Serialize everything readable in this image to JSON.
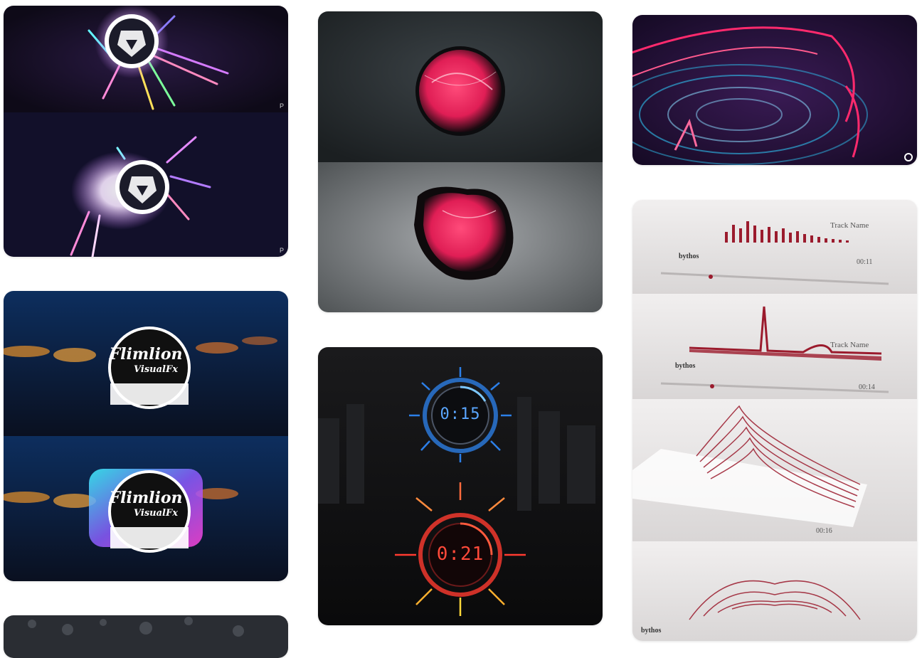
{
  "gallery": {
    "lion_card": {
      "watermark_top": "P",
      "watermark_bottom": "P"
    },
    "flimlion_card": {
      "logo_line1": "Flimlion",
      "logo_line2": "VisualFx"
    },
    "orb_card": {},
    "radar_card": {},
    "timer_card": {
      "timer_blue": "0:15",
      "timer_red": "0:21"
    },
    "wave3d_card": {
      "track_label": "Track Name",
      "brand_label": "bythos",
      "time_1": "00:11",
      "time_2": "00:14",
      "time_3": "00:16"
    }
  },
  "colors": {
    "accent_pink": "#ff2a6d",
    "accent_blue": "#2f8bff",
    "accent_red": "#ff3b30",
    "wave_red": "#9b1b2d"
  }
}
